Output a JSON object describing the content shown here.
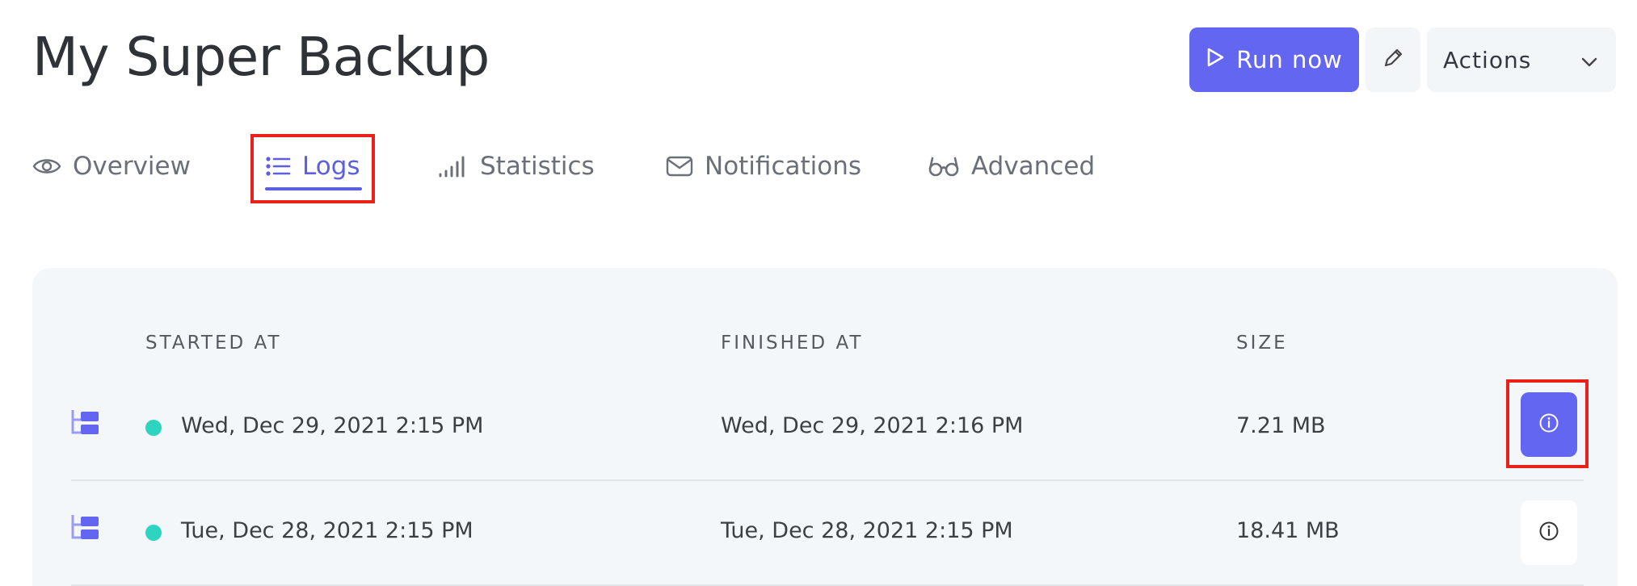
{
  "page": {
    "title": "My Super Backup"
  },
  "header": {
    "run_label": "Run now",
    "actions_label": "Actions"
  },
  "tabs": [
    {
      "label": "Overview",
      "icon": "eye-icon",
      "active": false
    },
    {
      "label": "Logs",
      "icon": "list-icon",
      "active": true
    },
    {
      "label": "Statistics",
      "icon": "signal-bars-icon",
      "active": false
    },
    {
      "label": "Notifications",
      "icon": "envelope-icon",
      "active": false
    },
    {
      "label": "Advanced",
      "icon": "glasses-icon",
      "active": false
    }
  ],
  "table": {
    "columns": [
      "STARTED AT",
      "FINISHED AT",
      "SIZE"
    ],
    "rows": [
      {
        "started": "Wed, Dec 29, 2021 2:15 PM",
        "finished": "Wed, Dec 29, 2021 2:16 PM",
        "size": "7.21 MB",
        "status": "success"
      },
      {
        "started": "Tue, Dec 28, 2021 2:15 PM",
        "finished": "Tue, Dec 28, 2021 2:15 PM",
        "size": "18.41 MB",
        "status": "success"
      }
    ]
  },
  "colors": {
    "accent": "#6366f1",
    "success": "#2dd4bf",
    "highlight": "#e8211b"
  }
}
